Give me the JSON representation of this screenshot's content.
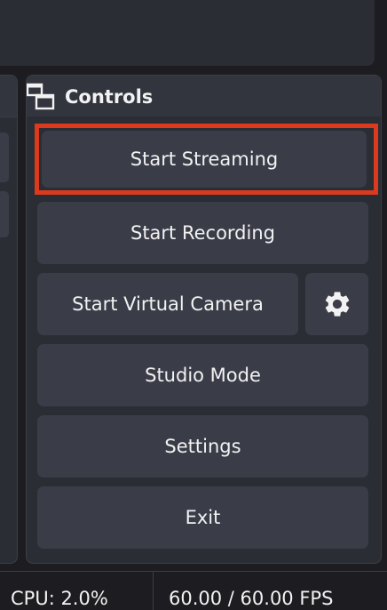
{
  "dock": {
    "title": "Controls",
    "icon": "dock-windows-icon"
  },
  "buttons": {
    "start_streaming": "Start Streaming",
    "start_recording": "Start Recording",
    "start_virtual_camera": "Start Virtual Camera",
    "virtual_camera_settings_icon": "gear-icon",
    "studio_mode": "Studio Mode",
    "settings": "Settings",
    "exit": "Exit"
  },
  "status_bar": {
    "cpu": "CPU: 2.0%",
    "fps": "60.00 / 60.00 FPS"
  },
  "colors": {
    "background": "#1c1c21",
    "panel": "#2b2d34",
    "button": "#3a3d48",
    "highlight": "#dc3a1f",
    "text": "#f2f2f2"
  }
}
